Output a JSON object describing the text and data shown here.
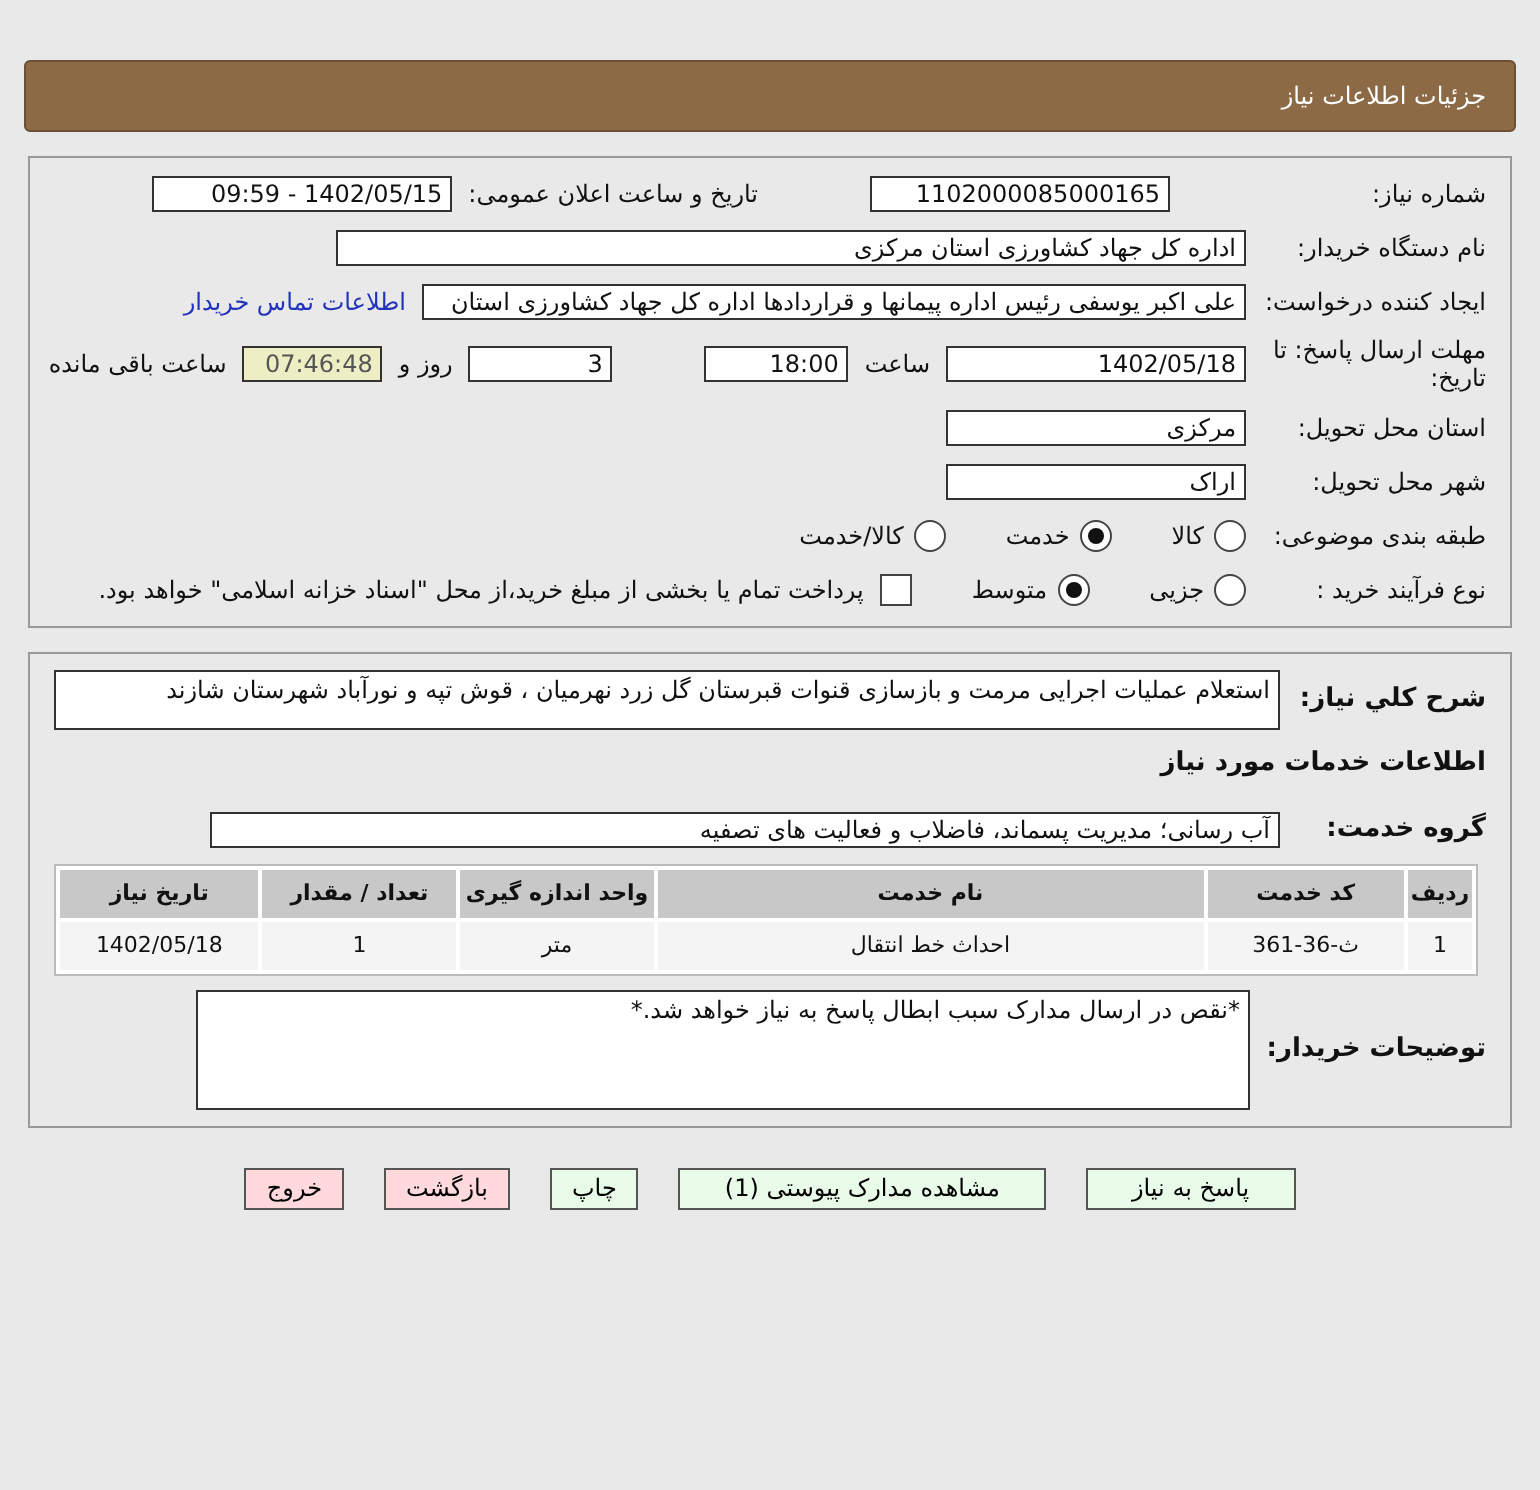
{
  "header": {
    "title": "جزئیات اطلاعات نیاز"
  },
  "details": {
    "need_number": {
      "label": "شماره نیاز:",
      "value": "1102000085000165"
    },
    "announce": {
      "label": "تاریخ و ساعت اعلان عمومی:",
      "value": "1402/05/15 - 09:59"
    },
    "buyer": {
      "label": "نام دستگاه خریدار:",
      "value": "اداره کل جهاد کشاورزی استان مرکزی"
    },
    "requester": {
      "label": "ایجاد کننده درخواست:",
      "value": "علی اکبر یوسفی رئیس اداره پیمانها و قراردادها اداره کل جهاد کشاورزی استان",
      "link": "اطلاعات تماس خریدار"
    },
    "deadline": {
      "label": "مهلت ارسال پاسخ: تا تاریخ:",
      "date": "1402/05/18",
      "time_label": "ساعت",
      "time": "18:00",
      "days": "3",
      "days_label": "روز و",
      "remaining": "07:46:48",
      "remaining_label": "ساعت باقی مانده"
    },
    "province": {
      "label": "استان محل تحویل:",
      "value": "مرکزی"
    },
    "city": {
      "label": "شهر محل تحویل:",
      "value": "اراک"
    },
    "category": {
      "label": "طبقه بندی موضوعی:",
      "options": [
        {
          "label": "کالا",
          "selected": false
        },
        {
          "label": "خدمت",
          "selected": true
        },
        {
          "label": "کالا/خدمت",
          "selected": false
        }
      ]
    },
    "process": {
      "label": "نوع فرآیند خرید :",
      "options": [
        {
          "label": "جزیی",
          "selected": false
        },
        {
          "label": "متوسط",
          "selected": true
        }
      ],
      "payment": {
        "checked": false,
        "text": "پرداخت تمام یا بخشی از مبلغ خرید،از محل \"اسناد خزانه اسلامی\" خواهد بود."
      }
    }
  },
  "summary": {
    "label": "شرح کلي نياز:",
    "value": "استعلام عملیات اجرایی مرمت و بازسازی قنوات قبرستان گل زرد نهرمیان  ، قوش تپه و نورآباد شهرستان شازند"
  },
  "services": {
    "title": "اطلاعات خدمات مورد نياز",
    "group_label": "گروه خدمت:",
    "group": "آب رسانی؛ مدیریت پسماند، فاضلاب و فعالیت های تصفیه",
    "table": {
      "columns": [
        "ردیف",
        "کد خدمت",
        "نام خدمت",
        "واحد اندازه گیری",
        "تعداد / مقدار",
        "تاریخ نیاز"
      ],
      "rows": [
        [
          "1",
          "ث-36-361",
          "احداث خط انتقال",
          "متر",
          "1",
          "1402/05/18"
        ]
      ]
    }
  },
  "notes": {
    "label": "توضیحات خریدار:",
    "value": "*نقص در ارسال مدارک سبب ابطال پاسخ به نیاز خواهد شد.*"
  },
  "buttons": [
    {
      "label": "پاسخ به نیاز",
      "color": "#e8fbe8"
    },
    {
      "label": "مشاهده مدارک پیوستی (1)",
      "color": "#e8fbe8"
    },
    {
      "label": "چاپ",
      "color": "#e8fbe8"
    },
    {
      "label": "بازگشت",
      "color": "#ffd9dc"
    },
    {
      "label": "خروج",
      "color": "#ffd9dc"
    }
  ]
}
